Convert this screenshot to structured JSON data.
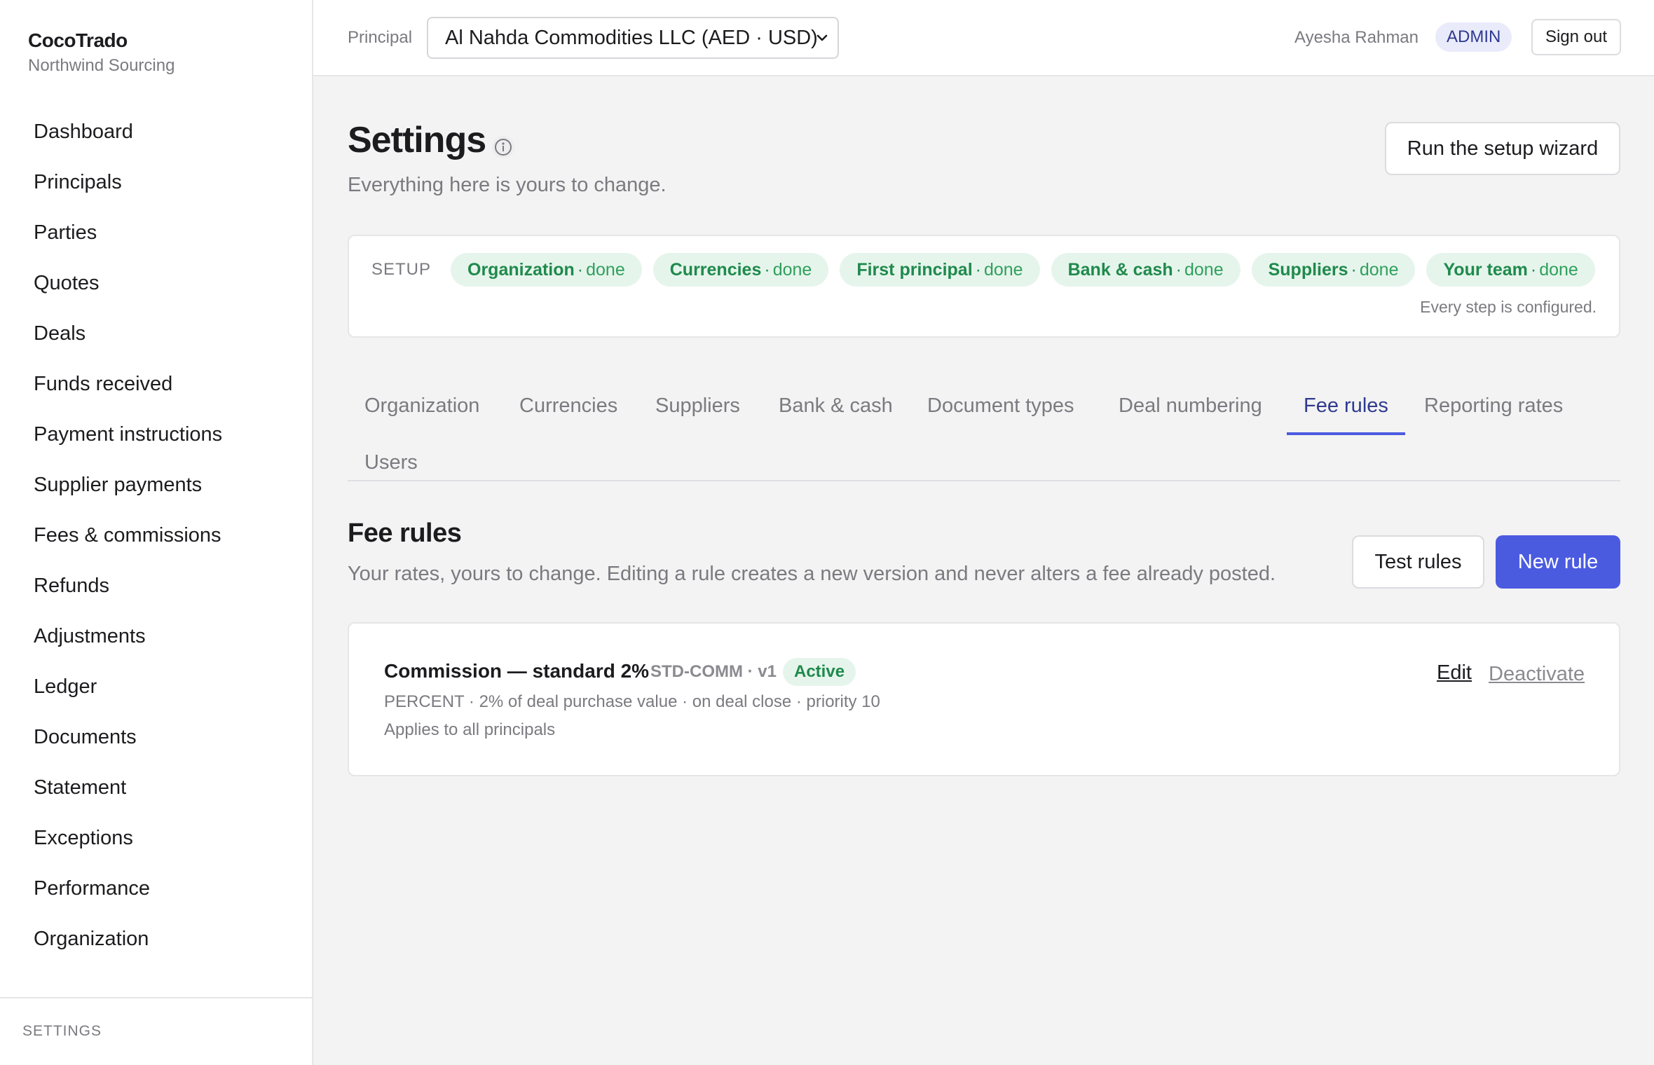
{
  "brand": {
    "name": "CocoTrado",
    "org": "Northwind Sourcing"
  },
  "nav": {
    "items": [
      {
        "label": "Dashboard"
      },
      {
        "label": "Principals"
      },
      {
        "label": "Parties"
      },
      {
        "label": "Quotes"
      },
      {
        "label": "Deals"
      },
      {
        "label": "Funds received"
      },
      {
        "label": "Payment instructions"
      },
      {
        "label": "Supplier payments"
      },
      {
        "label": "Fees & commissions"
      },
      {
        "label": "Refunds"
      },
      {
        "label": "Adjustments"
      },
      {
        "label": "Ledger"
      },
      {
        "label": "Documents"
      },
      {
        "label": "Statement"
      },
      {
        "label": "Exceptions"
      },
      {
        "label": "Performance"
      },
      {
        "label": "Organization"
      }
    ],
    "footer_label": "SETTINGS"
  },
  "topbar": {
    "principal_label": "Principal",
    "principal_value": "Al Nahda Commodities LLC (AED · USD)",
    "user_name": "Ayesha Rahman",
    "role": "ADMIN",
    "signout_label": "Sign out"
  },
  "page": {
    "title": "Settings",
    "subtitle": "Everything here is yours to change.",
    "wizard_label": "Run the setup wizard"
  },
  "setup": {
    "label": "SETUP",
    "separator": "·",
    "steps": [
      {
        "name": "Organization",
        "status": "done"
      },
      {
        "name": "Currencies",
        "status": "done"
      },
      {
        "name": "First principal",
        "status": "done"
      },
      {
        "name": "Bank & cash",
        "status": "done"
      },
      {
        "name": "Suppliers",
        "status": "done"
      },
      {
        "name": "Your team",
        "status": "done"
      }
    ],
    "note": "Every step is configured."
  },
  "tabs": [
    {
      "label": "Organization"
    },
    {
      "label": "Currencies"
    },
    {
      "label": "Suppliers"
    },
    {
      "label": "Bank & cash"
    },
    {
      "label": "Document types"
    },
    {
      "label": "Deal numbering"
    },
    {
      "label": "Fee rules"
    },
    {
      "label": "Reporting rates"
    },
    {
      "label": "Users"
    }
  ],
  "fee_rules": {
    "title": "Fee rules",
    "subtitle": "Your rates, yours to change. Editing a rule creates a new version and never alters a fee already posted.",
    "test_label": "Test rules",
    "new_label": "New rule",
    "rules": [
      {
        "name": "Commission — standard 2%",
        "code": "STD-COMM · v1",
        "status": "Active",
        "detail": "PERCENT · 2% of deal purchase value · on deal close · priority 10",
        "scope": "Applies to all principals",
        "edit_label": "Edit",
        "deactivate_label": "Deactivate"
      }
    ]
  },
  "colors": {
    "accent": "#4b5be0",
    "success": "#1f8a4c",
    "success_bg": "#e6f5ec",
    "admin_bg": "#e9ebfb"
  }
}
